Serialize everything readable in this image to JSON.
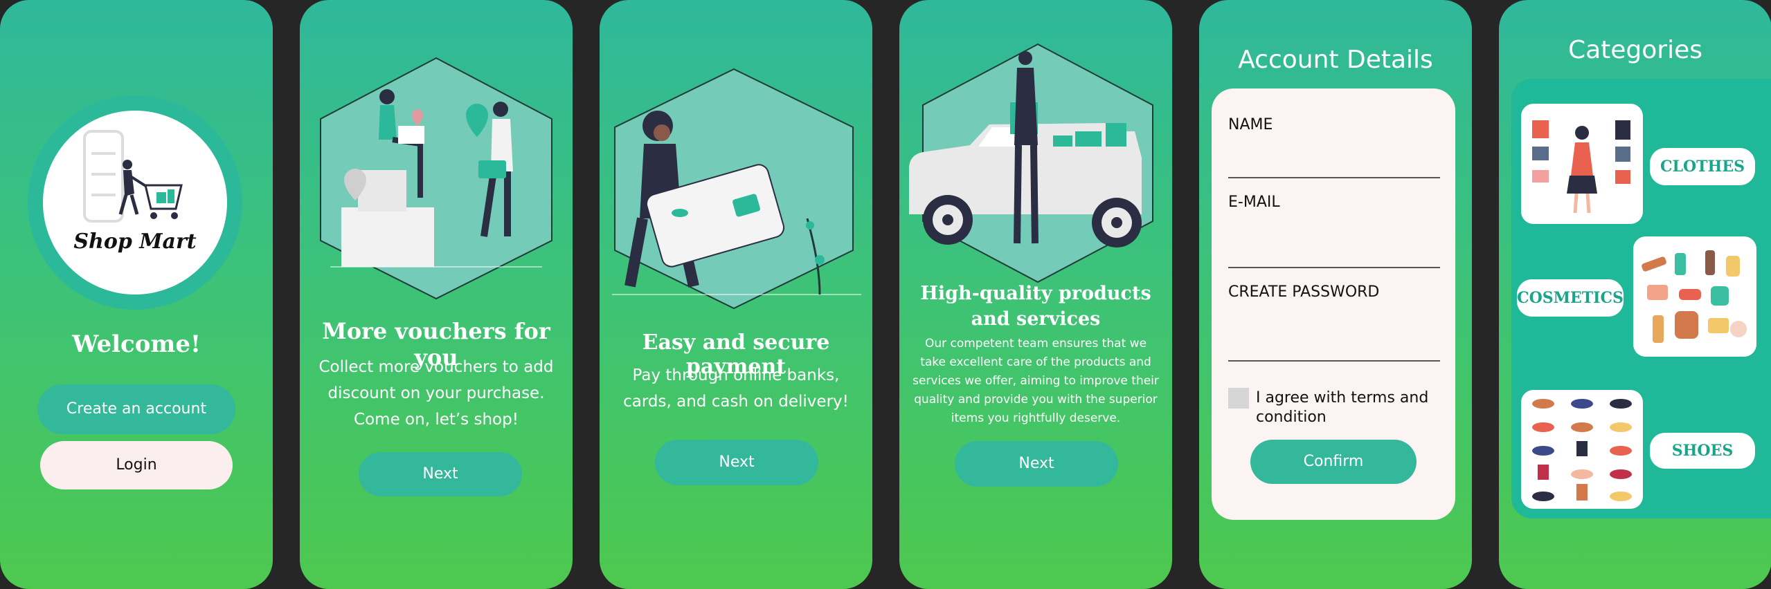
{
  "colors": {
    "teal": "#34b89c",
    "green": "#4ec84f",
    "dark_bg": "#262626",
    "card_white": "#fbf4f3"
  },
  "screen1": {
    "logo_text": "Shop Mart",
    "welcome": "Welcome!",
    "create_account": "Create an account",
    "login": "Login"
  },
  "screen2": {
    "title": "More vouchers for you",
    "body_lines": [
      "Collect more vouchers to add",
      "discount on your purchase.",
      "Come on, let’s shop!"
    ],
    "next": "Next"
  },
  "screen3": {
    "title": "Easy and secure payment",
    "body_lines": [
      "Pay through online banks,",
      "cards, and cash on delivery!"
    ],
    "next": "Next"
  },
  "screen4": {
    "title_lines": [
      "High-quality products",
      "and services"
    ],
    "body_lines": [
      "Our competent team ensures that we",
      "take excellent care of the products and",
      "services we offer, aiming to improve their",
      "quality and provide you with the superior",
      "items you rightfully deserve."
    ],
    "next": "Next"
  },
  "screen5": {
    "title": "Account Details",
    "fields": [
      "NAME",
      "E-MAIL",
      "CREATE PASSWORD"
    ],
    "terms_lines": [
      "I agree with terms and",
      "condition"
    ],
    "confirm": "Confirm"
  },
  "screen6": {
    "title": "Categories",
    "categories": [
      "CLOTHES",
      "COSMETICS",
      "SHOES"
    ]
  }
}
